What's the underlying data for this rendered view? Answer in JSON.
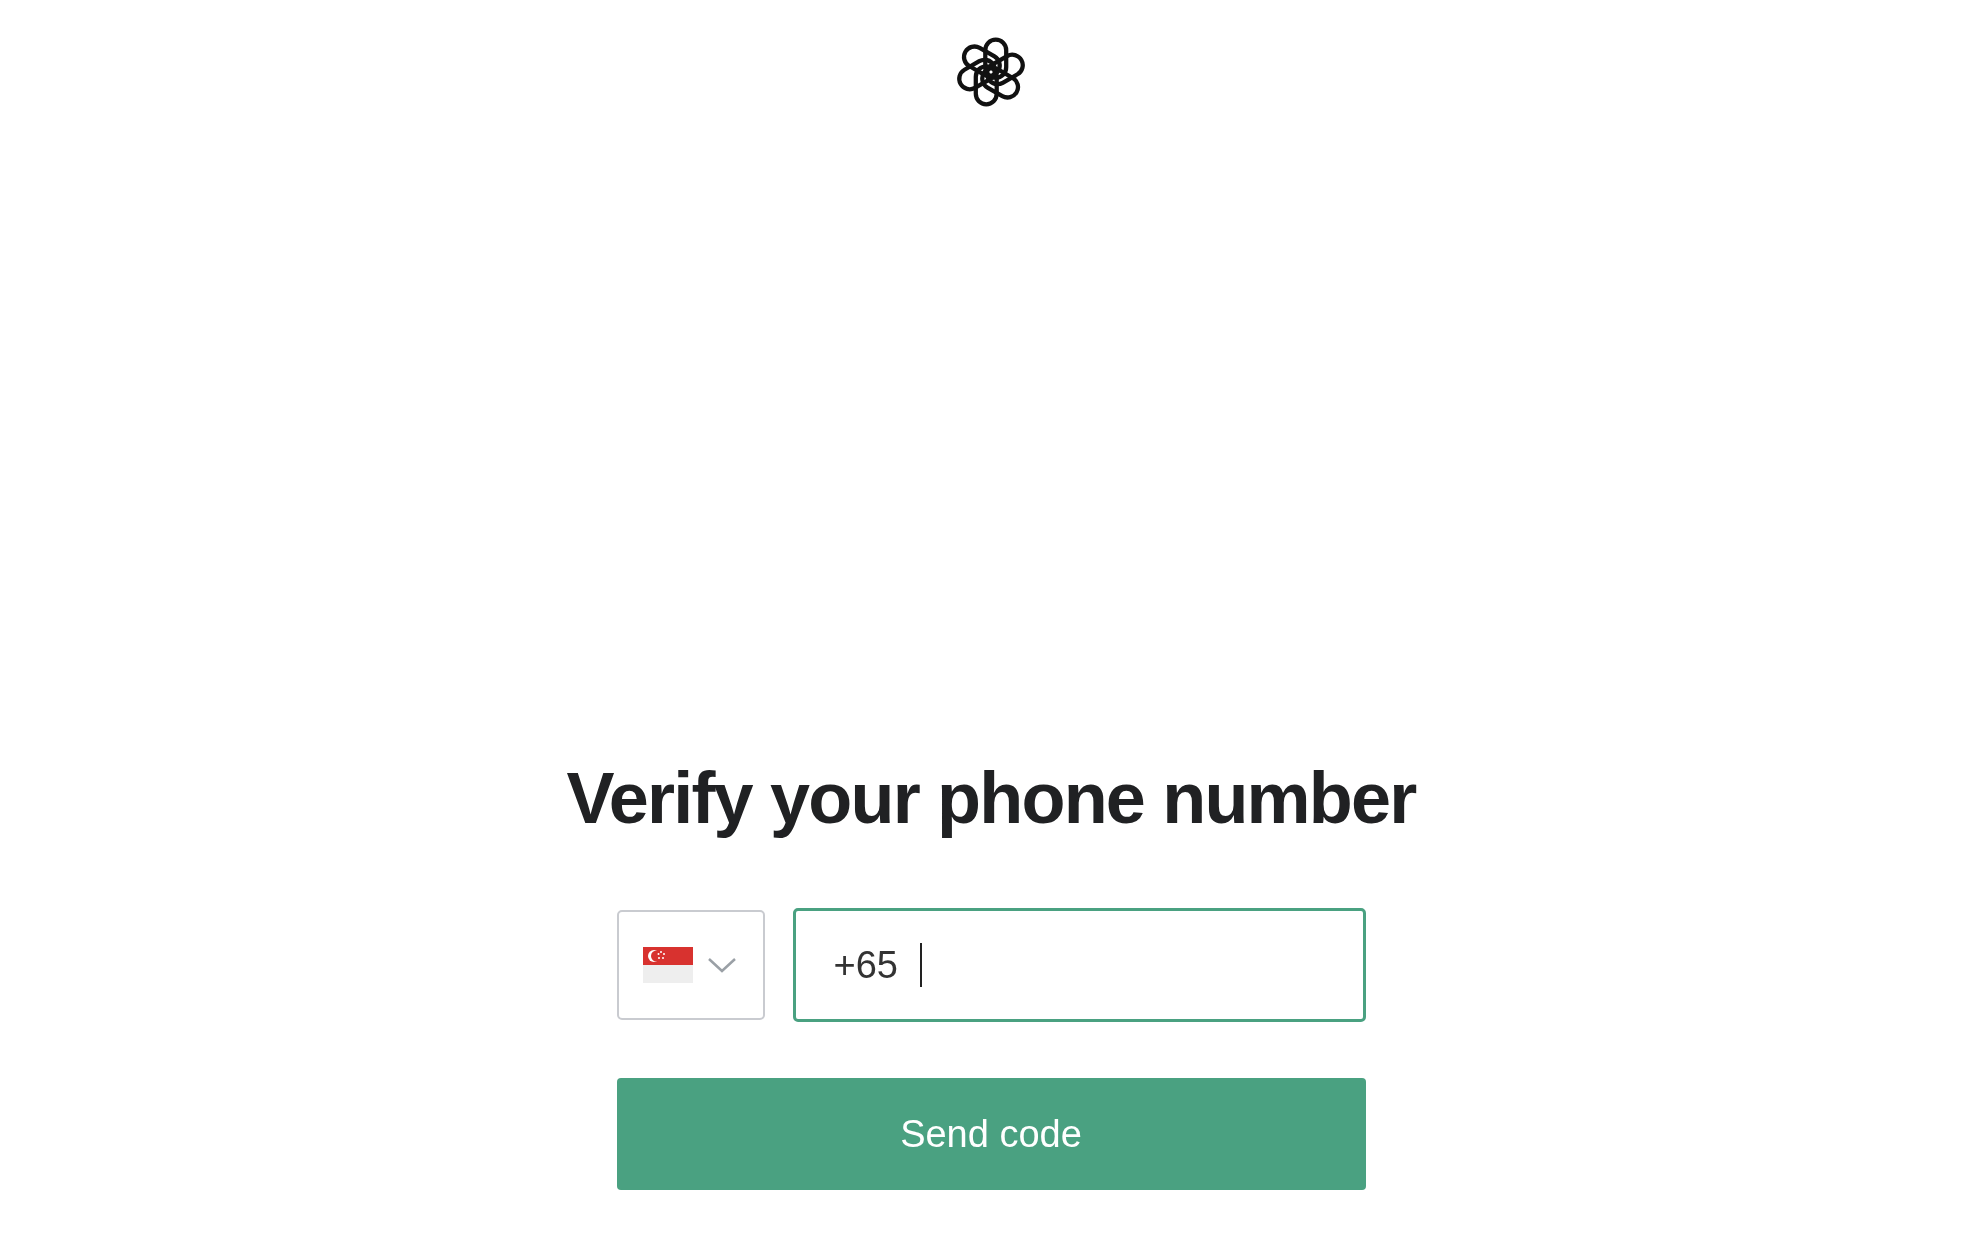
{
  "heading": "Verify your phone number",
  "phone_field": {
    "value": "+65",
    "focused": true
  },
  "send_button": {
    "label": "Send code"
  }
}
